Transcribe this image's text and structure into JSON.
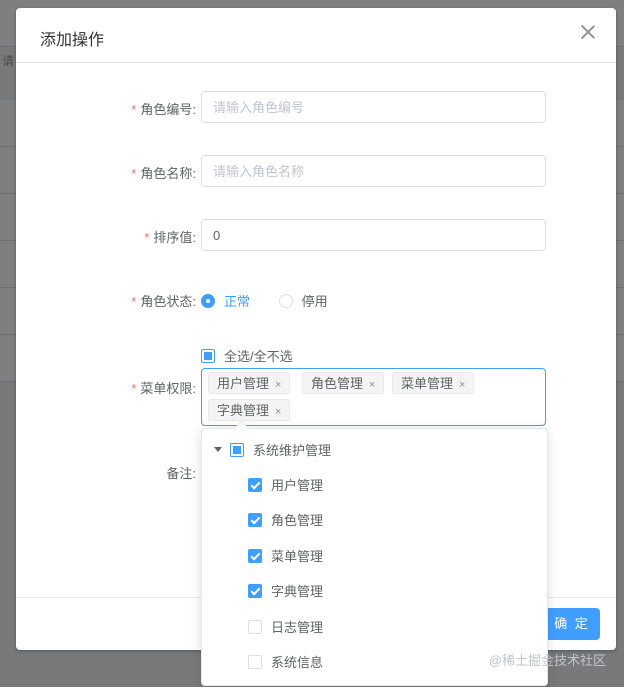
{
  "background": {
    "hint": "请"
  },
  "dialog": {
    "title": "添加操作",
    "close_icon": "close-icon",
    "fields": {
      "role_code": {
        "label": "角色编号:",
        "placeholder": "请输入角色编号",
        "value": ""
      },
      "role_name": {
        "label": "角色名称:",
        "placeholder": "请输入角色名称",
        "value": ""
      },
      "sort": {
        "label": "排序值:",
        "value": "0"
      },
      "status": {
        "label": "角色状态:",
        "options": [
          "正常",
          "停用"
        ],
        "selected": "正常"
      },
      "menu": {
        "label": "菜单权限:",
        "select_all": "全选/全不选",
        "tags": [
          "用户管理",
          "角色管理",
          "菜单管理",
          "字典管理"
        ],
        "tag_close": "×"
      },
      "remark": {
        "label": "备注:"
      }
    },
    "confirm_label": "确 定"
  },
  "tree": {
    "parent": {
      "label": "系统维护管理",
      "state": "indeterminate"
    },
    "children": [
      {
        "label": "用户管理",
        "checked": true
      },
      {
        "label": "角色管理",
        "checked": true
      },
      {
        "label": "菜单管理",
        "checked": true
      },
      {
        "label": "字典管理",
        "checked": true
      },
      {
        "label": "日志管理",
        "checked": false
      },
      {
        "label": "系统信息",
        "checked": false
      }
    ]
  },
  "watermark": "@稀土掘金技术社区",
  "colors": {
    "primary": "#409eff",
    "required": "#f56c6c",
    "mask": "rgba(0,0,0,0.5)"
  }
}
